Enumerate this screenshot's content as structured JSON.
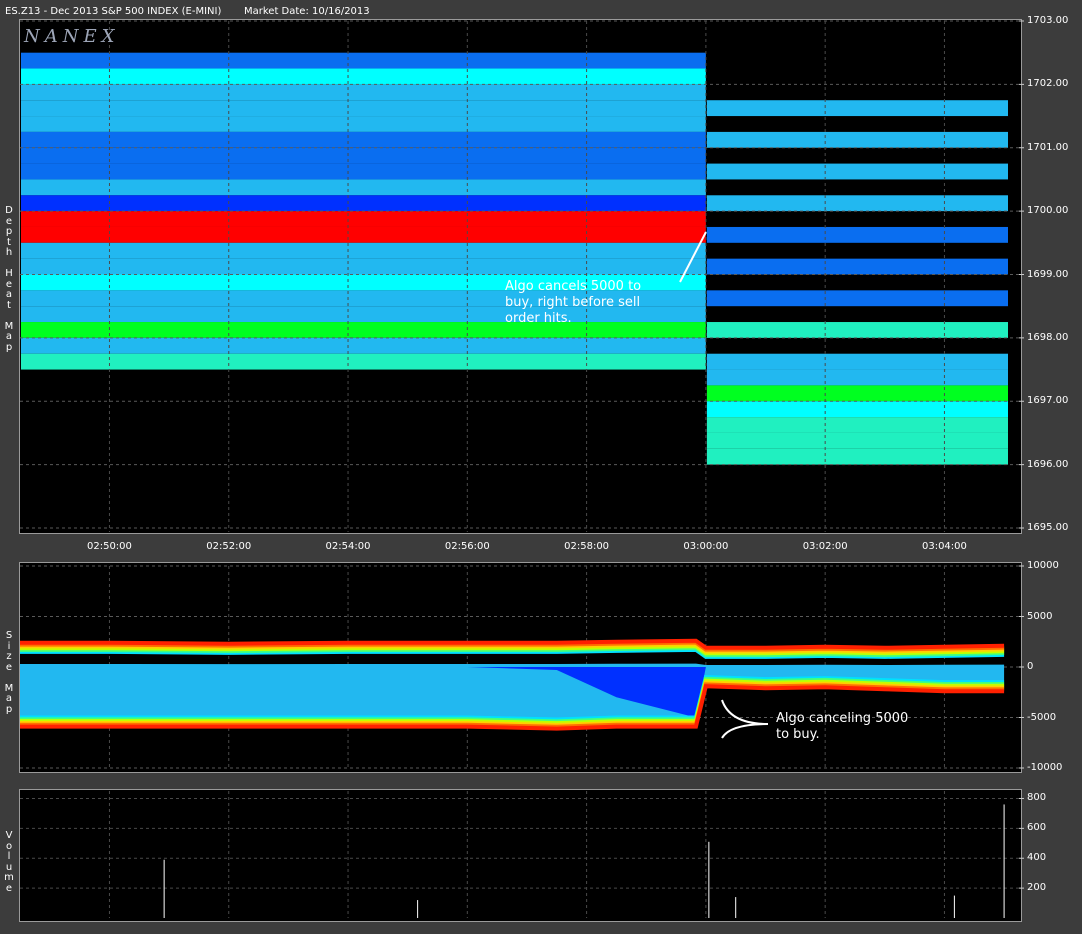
{
  "header": {
    "symbol": "ES.Z13 - Dec 2013 S&P 500 INDEX (E-MINI)",
    "market_date": "Market Date: 10/16/2013"
  },
  "logo": "NANEX",
  "panels": {
    "depth_label": "D\ne\np\nt\nh\n \nH\ne\na\nt\n \nM\na\np",
    "size_label": "S\ni\nz\ne\n \nM\na\np",
    "volume_label": "V\no\nl\nu\nm\ne"
  },
  "annotations": {
    "depth": "Algo cancels 5000 to\nbuy, right before sell\norder hits.",
    "size": "Algo canceling 5000\nto buy."
  },
  "colors": {
    "cyan": "#00ffff",
    "light_blue": "#22b8f0",
    "blue": "#0a6ef0",
    "dark_blue": "#0030ff",
    "teal": "#20f0c0",
    "green": "#00ff20",
    "red": "#ff0000",
    "yellow": "#ffd000"
  },
  "chart_data": [
    {
      "type": "heatmap",
      "title": "Depth Heat Map",
      "x_tick_labels": [
        "02:50:00",
        "02:52:00",
        "02:54:00",
        "02:56:00",
        "02:58:00",
        "03:00:00",
        "03:02:00",
        "03:04:00"
      ],
      "y_tick_labels": [
        "1703.00",
        "1702.00",
        "1701.00",
        "1700.00",
        "1699.00",
        "1698.00",
        "1697.00",
        "1696.00",
        "1695.00"
      ],
      "ylim": [
        1695.0,
        1703.0
      ],
      "xlim": [
        "02:48:30",
        "03:05:15"
      ],
      "before_0300": {
        "1702.25": "blue",
        "1702.00": "cyan",
        "1701.75": "light_blue",
        "1701.50": "light_blue",
        "1701.25": "light_blue",
        "1701.00": "blue",
        "1700.75": "blue",
        "1700.50": "blue",
        "1700.25": "light_blue",
        "1700.00": "dark_blue",
        "1699.75": "red",
        "1699.50": "red",
        "1699.25": "light_blue",
        "1699.00": "light_blue",
        "1698.75": "cyan",
        "1698.50": "light_blue",
        "1698.25": "light_blue",
        "1698.00": "green",
        "1697.75": "light_blue",
        "1697.50": "teal"
      },
      "after_0300": {
        "1701.50": "light_blue",
        "1701.00": "light_blue",
        "1700.50": "light_blue",
        "1700.00": "light_blue",
        "1699.50": "blue",
        "1699.00": "blue",
        "1698.50": "blue",
        "1698.00": "teal",
        "1697.50": "light_blue",
        "1697.25": "light_blue",
        "1697.00": "green",
        "1696.75": "cyan",
        "1696.50": "teal",
        "1696.25": "teal",
        "1696.00": "teal"
      }
    },
    {
      "type": "area",
      "title": "Size Map",
      "y_tick_labels": [
        "10000",
        "5000",
        "0",
        "-5000",
        "-10000"
      ],
      "ylim": [
        -10000,
        10000
      ],
      "x": [
        "02:48:30",
        "02:50:00",
        "02:52:00",
        "02:54:00",
        "02:56:00",
        "02:57:30",
        "02:58:30",
        "02:59:50",
        "03:00:00",
        "03:01:00",
        "03:02:00",
        "03:03:00",
        "03:04:00",
        "03:05:00"
      ],
      "bid_size": [
        -5000,
        -5000,
        -5000,
        -5000,
        -5000,
        -5200,
        -5000,
        -5000,
        -1000,
        -1200,
        -1100,
        -1300,
        -1500,
        -1500
      ],
      "ask_size": [
        1500,
        1500,
        1400,
        1500,
        1500,
        1500,
        1600,
        1700,
        1000,
        1000,
        1100,
        1000,
        1100,
        1200
      ],
      "cancelled_bid": [
        0,
        0,
        0,
        0,
        0,
        -300,
        -3000,
        -5000,
        0,
        0,
        0,
        0,
        0,
        0
      ]
    },
    {
      "type": "bar",
      "title": "Volume",
      "y_tick_labels": [
        "800",
        "600",
        "400",
        "200"
      ],
      "ylim": [
        0,
        850
      ],
      "spikes": [
        {
          "x": "02:50:55",
          "y": 390
        },
        {
          "x": "02:55:10",
          "y": 120
        },
        {
          "x": "03:00:03",
          "y": 510
        },
        {
          "x": "03:00:30",
          "y": 140
        },
        {
          "x": "03:04:10",
          "y": 150
        },
        {
          "x": "03:05:00",
          "y": 760
        }
      ]
    }
  ]
}
